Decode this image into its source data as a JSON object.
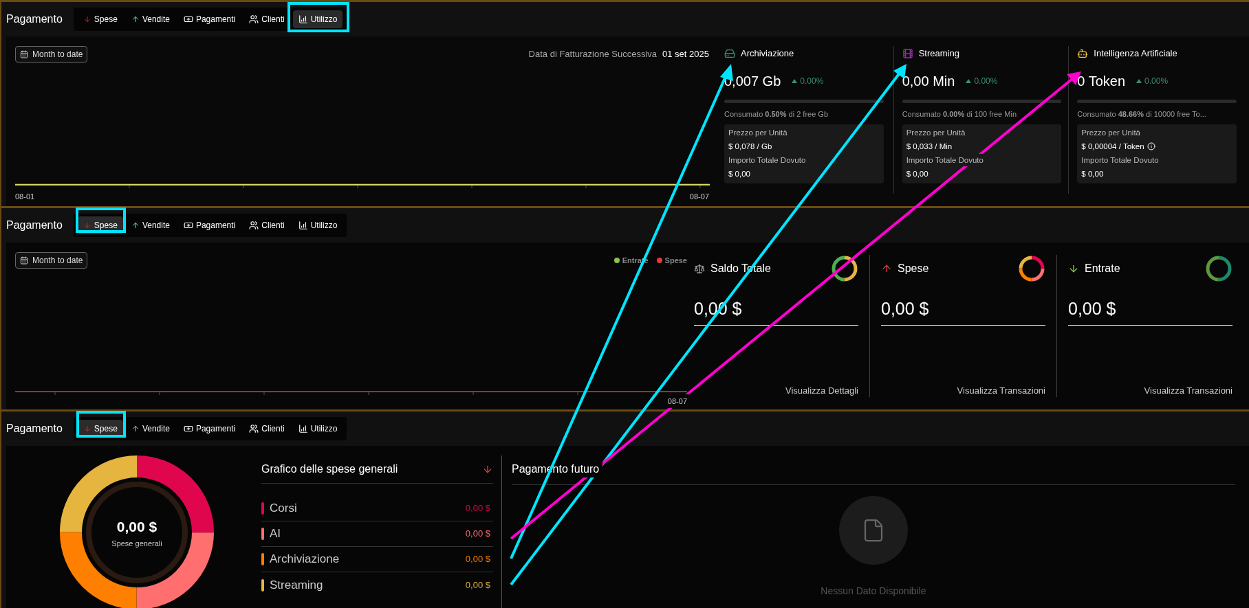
{
  "panels": [
    {
      "kind": "usage",
      "title": "Pagamento",
      "tabs": [
        {
          "label": "Spese",
          "selected": false
        },
        {
          "label": "Vendite",
          "selected": false
        },
        {
          "label": "Pagamenti",
          "selected": false
        },
        {
          "label": "Clienti",
          "selected": false
        },
        {
          "label": "Utilizzo",
          "selected": true
        }
      ],
      "range_button": "Month to date",
      "billing_label": "Data di Fatturazione Successiva",
      "billing_date": "01 set 2025",
      "x_start": "08-01",
      "x_end": "08-07",
      "meters": [
        {
          "name": "Archiviazione",
          "value": "0,007 Gb",
          "trend": "0.00%",
          "level": 0,
          "usage": "Consumato **0.50%** di 2 free Gb",
          "price_label": "Prezzo per Unità",
          "price": "$ 0,078 / Gb",
          "info": false,
          "due_label": "Importo Totale Dovuto",
          "due": "$ 0,00"
        },
        {
          "name": "Streaming",
          "value": "0,00 Min",
          "trend": "0.00%",
          "level": 0,
          "usage": "Consumato **0.00%** di 100 free Min",
          "price_label": "Prezzo per Unità",
          "price": "$ 0,033 / Min",
          "info": false,
          "due_label": "Importo Totale Dovuto",
          "due": "$ 0,00"
        },
        {
          "name": "Intelligenza Artificiale",
          "value": "0 Token",
          "trend": "0.00%",
          "level": 0,
          "usage": "Consumato **48.66%** di 10000 free To...",
          "price_label": "Prezzo per Unità",
          "price": "$ 0,00004 / Token",
          "info": true,
          "due_label": "Importo Totale Dovuto",
          "due": "$ 0,00"
        }
      ]
    },
    {
      "kind": "balance",
      "title": "Pagamento",
      "tabs": [
        {
          "label": "Spese",
          "selected": true
        },
        {
          "label": "Vendite",
          "selected": false
        },
        {
          "label": "Pagamenti",
          "selected": false
        },
        {
          "label": "Clienti",
          "selected": false
        },
        {
          "label": "Utilizzo",
          "selected": false
        }
      ],
      "range_button": "Month to date",
      "legend": [
        {
          "label": "Entrate",
          "color": "#8bc34a"
        },
        {
          "label": "Spese",
          "color": "#e53935"
        }
      ],
      "x_end": "08-07",
      "cards": [
        {
          "title": "Saldo Totale",
          "amount": "0,00 $",
          "link": "Visualizza Dettagli"
        },
        {
          "title": "Spese",
          "amount": "0,00 $",
          "link": "Visualizza Transazioni"
        },
        {
          "title": "Entrate",
          "amount": "0,00 $",
          "link": "Visualizza Transazioni"
        }
      ]
    },
    {
      "kind": "expenses",
      "title": "Pagamento",
      "tabs": [
        {
          "label": "Spese",
          "selected": true
        },
        {
          "label": "Vendite",
          "selected": false
        },
        {
          "label": "Pagamenti",
          "selected": false
        },
        {
          "label": "Clienti",
          "selected": false
        },
        {
          "label": "Utilizzo",
          "selected": false
        }
      ],
      "donut": {
        "amount": "0,00 $",
        "caption": "Spese generali"
      },
      "breakdown": {
        "title": "Grafico delle spese generali",
        "items": [
          {
            "name": "Corsi",
            "amount": "0,00 $",
            "color": "#e0064e"
          },
          {
            "name": "AI",
            "amount": "0,00 $",
            "color": "#ff6f6f"
          },
          {
            "name": "Archiviazione",
            "amount": "0,00 $",
            "color": "#ff7f00"
          },
          {
            "name": "Streaming",
            "amount": "0,00 $",
            "color": "#e5b53f"
          }
        ]
      },
      "upcoming": {
        "title": "Pagamento futuro",
        "empty": "Nessun Dato Disponibile"
      }
    }
  ]
}
